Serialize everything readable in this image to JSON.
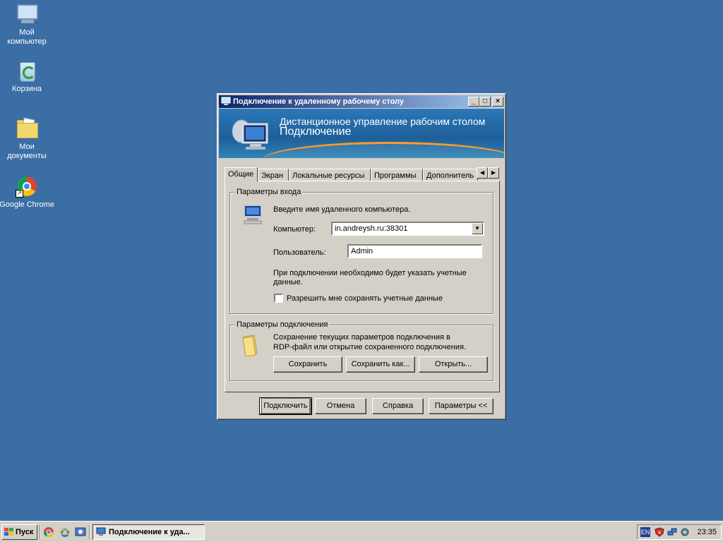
{
  "desktop": {
    "icons": [
      {
        "name": "my-computer",
        "label": "Мой компьютер",
        "icon": "computer-icon"
      },
      {
        "name": "recycle-bin",
        "label": "Корзина",
        "icon": "recycle-bin-icon"
      },
      {
        "name": "my-documents",
        "label": "Мои документы",
        "icon": "documents-folder-icon"
      },
      {
        "name": "google-chrome",
        "label": "Google Chrome",
        "icon": "chrome-icon"
      }
    ]
  },
  "window": {
    "title": "Подключение к удаленному рабочему столу",
    "controls": {
      "minimize": "_",
      "maximize": "□",
      "close": "×"
    },
    "banner": {
      "line1": "Дистанционное управление рабочим столом",
      "line2": "Подключение"
    },
    "tabs": [
      "Общие",
      "Экран",
      "Локальные ресурсы",
      "Программы",
      "Дополнитель"
    ],
    "tab_scroll": {
      "left": "◀",
      "right": "▶"
    },
    "login_group": {
      "label": "Параметры входа",
      "hint": "Введите имя удаленного компьютера.",
      "computer_label": "Компьютер:",
      "computer_value": "in.andreysh.ru:38301",
      "user_label": "Пользователь:",
      "user_value": "Admin",
      "note_line1": "При подключении необходимо будет указать учетные",
      "note_line2": "данные.",
      "save_creds_label": "Разрешить мне сохранять учетные данные"
    },
    "connection_group": {
      "label": "Параметры подключения",
      "text_line1": "Сохранение текущих параметров подключения в",
      "text_line2": "RDP-файл или открытие сохраненного подключения.",
      "save": "Сохранить",
      "save_as": "Сохранить как...",
      "open": "Открыть..."
    },
    "buttons": {
      "connect": "Подключить",
      "cancel": "Отмена",
      "help": "Справка",
      "options": "Параметры <<"
    }
  },
  "taskbar": {
    "start": "Пуск",
    "task": "Подключение к уда...",
    "lang": "EN",
    "clock": "23:35"
  }
}
